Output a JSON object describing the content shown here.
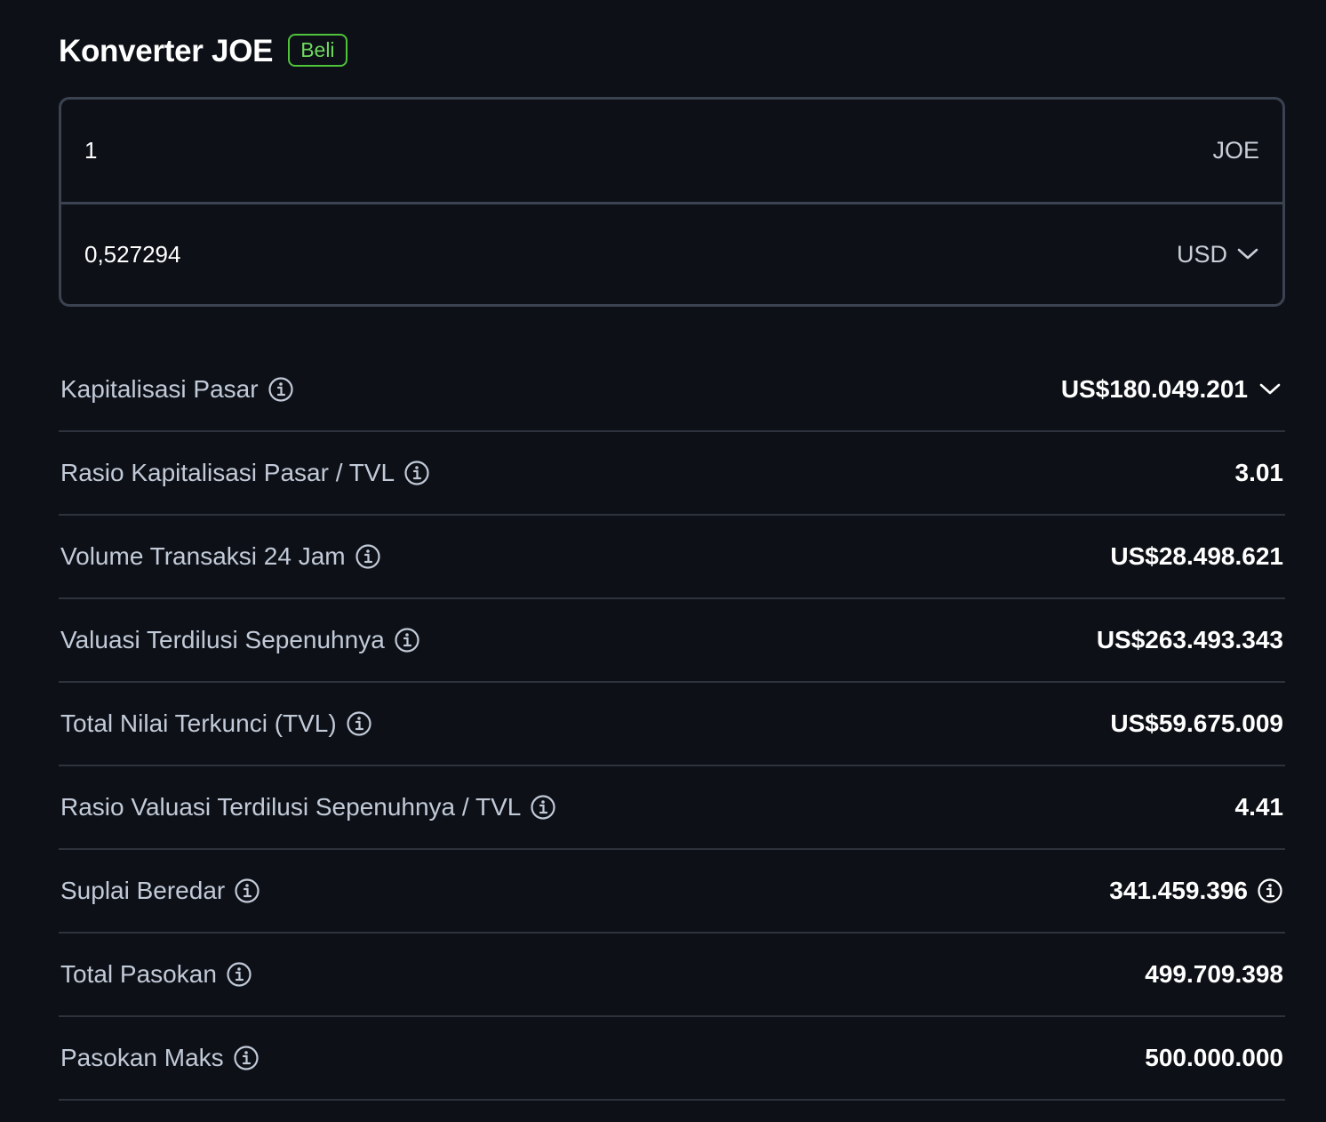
{
  "header": {
    "title": "Konverter JOE",
    "badge": "Beli"
  },
  "converter": {
    "from": {
      "value": "1",
      "unit": "JOE"
    },
    "to": {
      "value": "0,527294",
      "unit": "USD"
    }
  },
  "stats": [
    {
      "label": "Kapitalisasi Pasar",
      "value": "US$180.049.201",
      "value_icon": "chevron-down-icon"
    },
    {
      "label": "Rasio Kapitalisasi Pasar / TVL",
      "value": "3.01"
    },
    {
      "label": "Volume Transaksi 24 Jam",
      "value": "US$28.498.621"
    },
    {
      "label": "Valuasi Terdilusi Sepenuhnya",
      "value": "US$263.493.343"
    },
    {
      "label": "Total Nilai Terkunci (TVL)",
      "value": "US$59.675.009"
    },
    {
      "label": "Rasio Valuasi Terdilusi Sepenuhnya / TVL",
      "value": "4.41"
    },
    {
      "label": "Suplai Beredar",
      "value": "341.459.396",
      "value_icon": "info-icon"
    },
    {
      "label": "Total Pasokan",
      "value": "499.709.398"
    },
    {
      "label": "Pasokan Maks",
      "value": "500.000.000"
    }
  ],
  "colors": {
    "background": "#0d1117",
    "badge_green": "#4ec33b",
    "border": "#3b4250",
    "label": "#c2cad8"
  }
}
